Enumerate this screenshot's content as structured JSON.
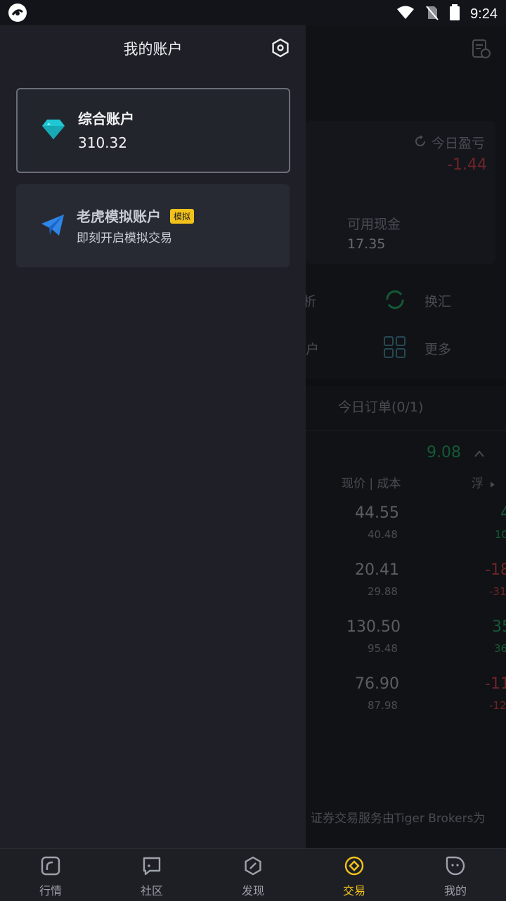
{
  "status": {
    "time": "9:24"
  },
  "drawer": {
    "title": "我的账户",
    "accounts": [
      {
        "name": "综合账户",
        "value": "310.32"
      },
      {
        "name": "老虎模拟账户",
        "badge": "模拟",
        "subtitle": "即刻开启模拟交易"
      }
    ]
  },
  "background": {
    "today_pl_label": "今日盈亏",
    "today_pl_value": "-1.44",
    "cash_label": "可用现金",
    "cash_value": "17.35",
    "menu": [
      {
        "label": "分析",
        "partial": true
      },
      {
        "label": "换汇"
      },
      {
        "label": "账户",
        "partial": true
      },
      {
        "label": "更多"
      }
    ],
    "tab_orders": "今日订单(0/1)",
    "summary_value": "9.08",
    "col_price_cost": "现价 | 成本",
    "col_float": "浮",
    "holdings": [
      {
        "price": "44.55",
        "cost": "40.48",
        "pl": "4",
        "pl_sub": "10",
        "color": "green"
      },
      {
        "price": "20.41",
        "cost": "29.88",
        "pl": "-18",
        "pl_sub": "-31",
        "color": "red"
      },
      {
        "price": "130.50",
        "cost": "95.48",
        "pl": "35",
        "pl_sub": "36",
        "color": "green"
      },
      {
        "price": "76.90",
        "cost": "87.98",
        "pl": "-11",
        "pl_sub": "-12",
        "color": "red"
      }
    ],
    "footer_text": "证券交易服务由Tiger Brokers为"
  },
  "bottom_nav": [
    {
      "label": "行情",
      "icon": "market-icon"
    },
    {
      "label": "社区",
      "icon": "community-icon"
    },
    {
      "label": "发现",
      "icon": "discover-icon"
    },
    {
      "label": "交易",
      "icon": "trade-icon",
      "active": true
    },
    {
      "label": "我的",
      "icon": "profile-icon"
    }
  ],
  "colors": {
    "accent": "#f2c21b",
    "drawer_bg": "#1f2027",
    "green": "#1f8a55",
    "red": "#a8383c"
  }
}
